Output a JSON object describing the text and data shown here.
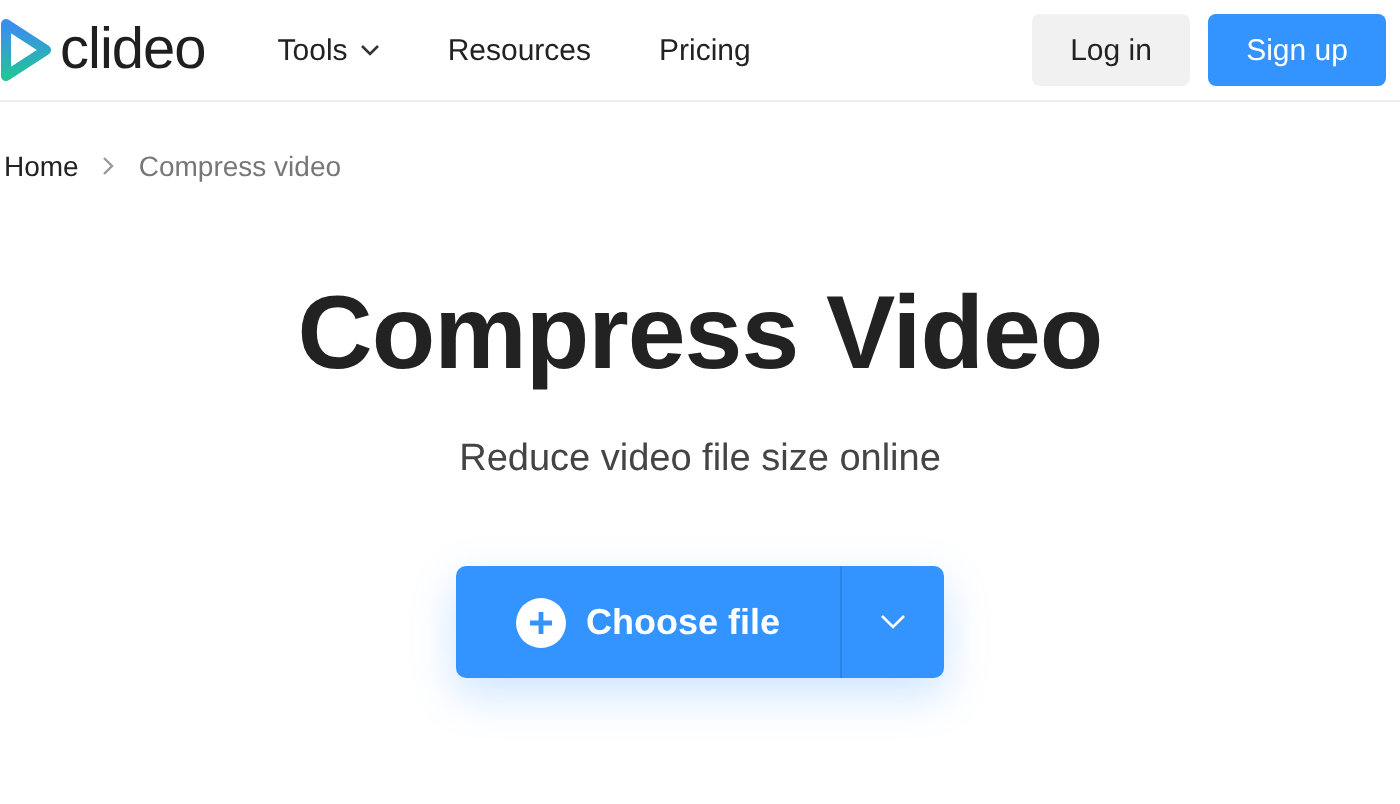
{
  "header": {
    "logo": "clideo",
    "nav": [
      {
        "label": "Tools",
        "kind": "dropdown"
      },
      {
        "label": "Resources",
        "kind": "link"
      },
      {
        "label": "Pricing",
        "kind": "link"
      }
    ],
    "login": "Log in",
    "signup": "Sign up"
  },
  "breadcrumb": [
    "Home",
    "Compress video"
  ],
  "hero": {
    "title": "Compress Video",
    "subtitle": "Reduce video file size online",
    "button": "Choose file"
  }
}
